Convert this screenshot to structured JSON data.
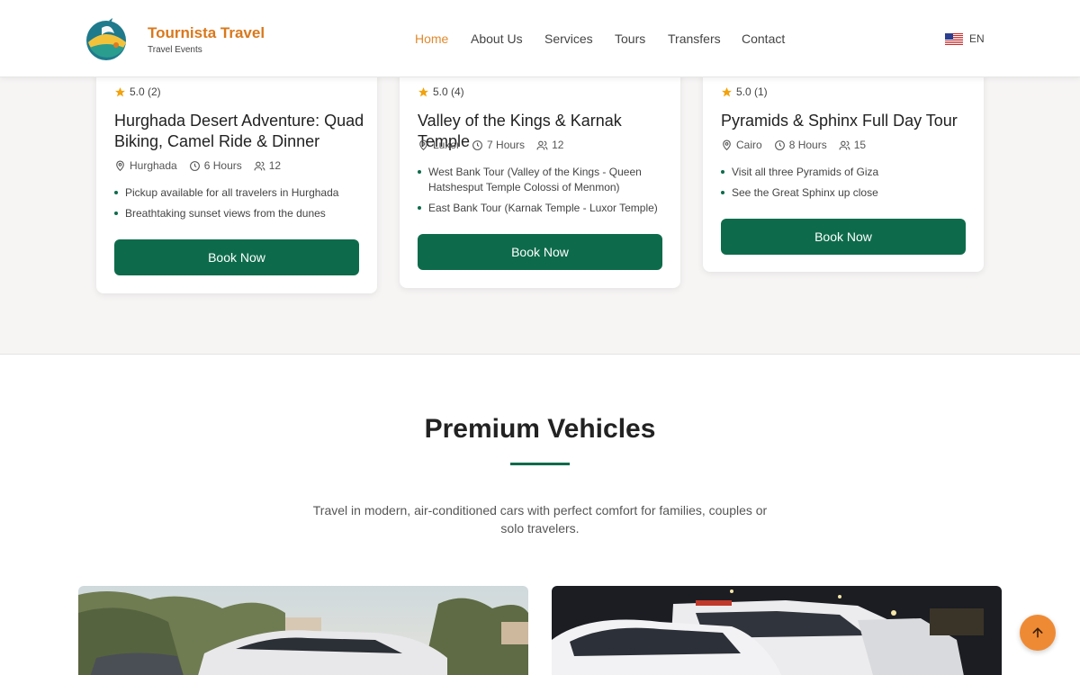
{
  "header": {
    "brand_name": "Tournista Travel",
    "brand_sub": "Travel Events",
    "nav": [
      "Home",
      "About Us",
      "Services",
      "Tours",
      "Transfers",
      "Contact"
    ],
    "active_nav": "Home",
    "language": "EN"
  },
  "tours": [
    {
      "rating": "5.0 (2)",
      "title": "Hurghada Desert Adventure: Quad Biking, Camel Ride & Dinner",
      "location": "Hurghada",
      "duration": "6 Hours",
      "group": "12",
      "bullets": [
        "Pickup available for all travelers in Hurghada",
        "Breathtaking sunset views from the dunes"
      ],
      "button": "Book Now"
    },
    {
      "rating": "5.0 (4)",
      "title": "Valley of the Kings & Karnak Temple",
      "location": "Luxor",
      "duration": "7 Hours",
      "group": "12",
      "bullets": [
        "West Bank Tour (Valley of the Kings - Queen Hatshesput Temple Colossi of Menmon)",
        "East Bank Tour (Karnak Temple - Luxor Temple)"
      ],
      "button": "Book Now"
    },
    {
      "rating": "5.0 (1)",
      "title": "Pyramids & Sphinx Full Day Tour",
      "location": "Cairo",
      "duration": "8 Hours",
      "group": "15",
      "bullets": [
        "Visit all three Pyramids of Giza",
        "See the Great Sphinx up close"
      ],
      "button": "Book Now"
    }
  ],
  "vehicles": {
    "title": "Premium Vehicles",
    "description": "Travel in modern, air-conditioned cars with perfect comfort for families, couples or solo travelers."
  },
  "colors": {
    "primary_green": "#0d6b4b",
    "brand_orange": "#d9781c",
    "scroll_button": "#ef8a34",
    "star": "#f2a20c"
  },
  "icons": {
    "location": "map-pin-icon",
    "duration": "clock-icon",
    "group": "users-icon",
    "rating": "star-icon",
    "scroll_top": "arrow-up-icon"
  }
}
